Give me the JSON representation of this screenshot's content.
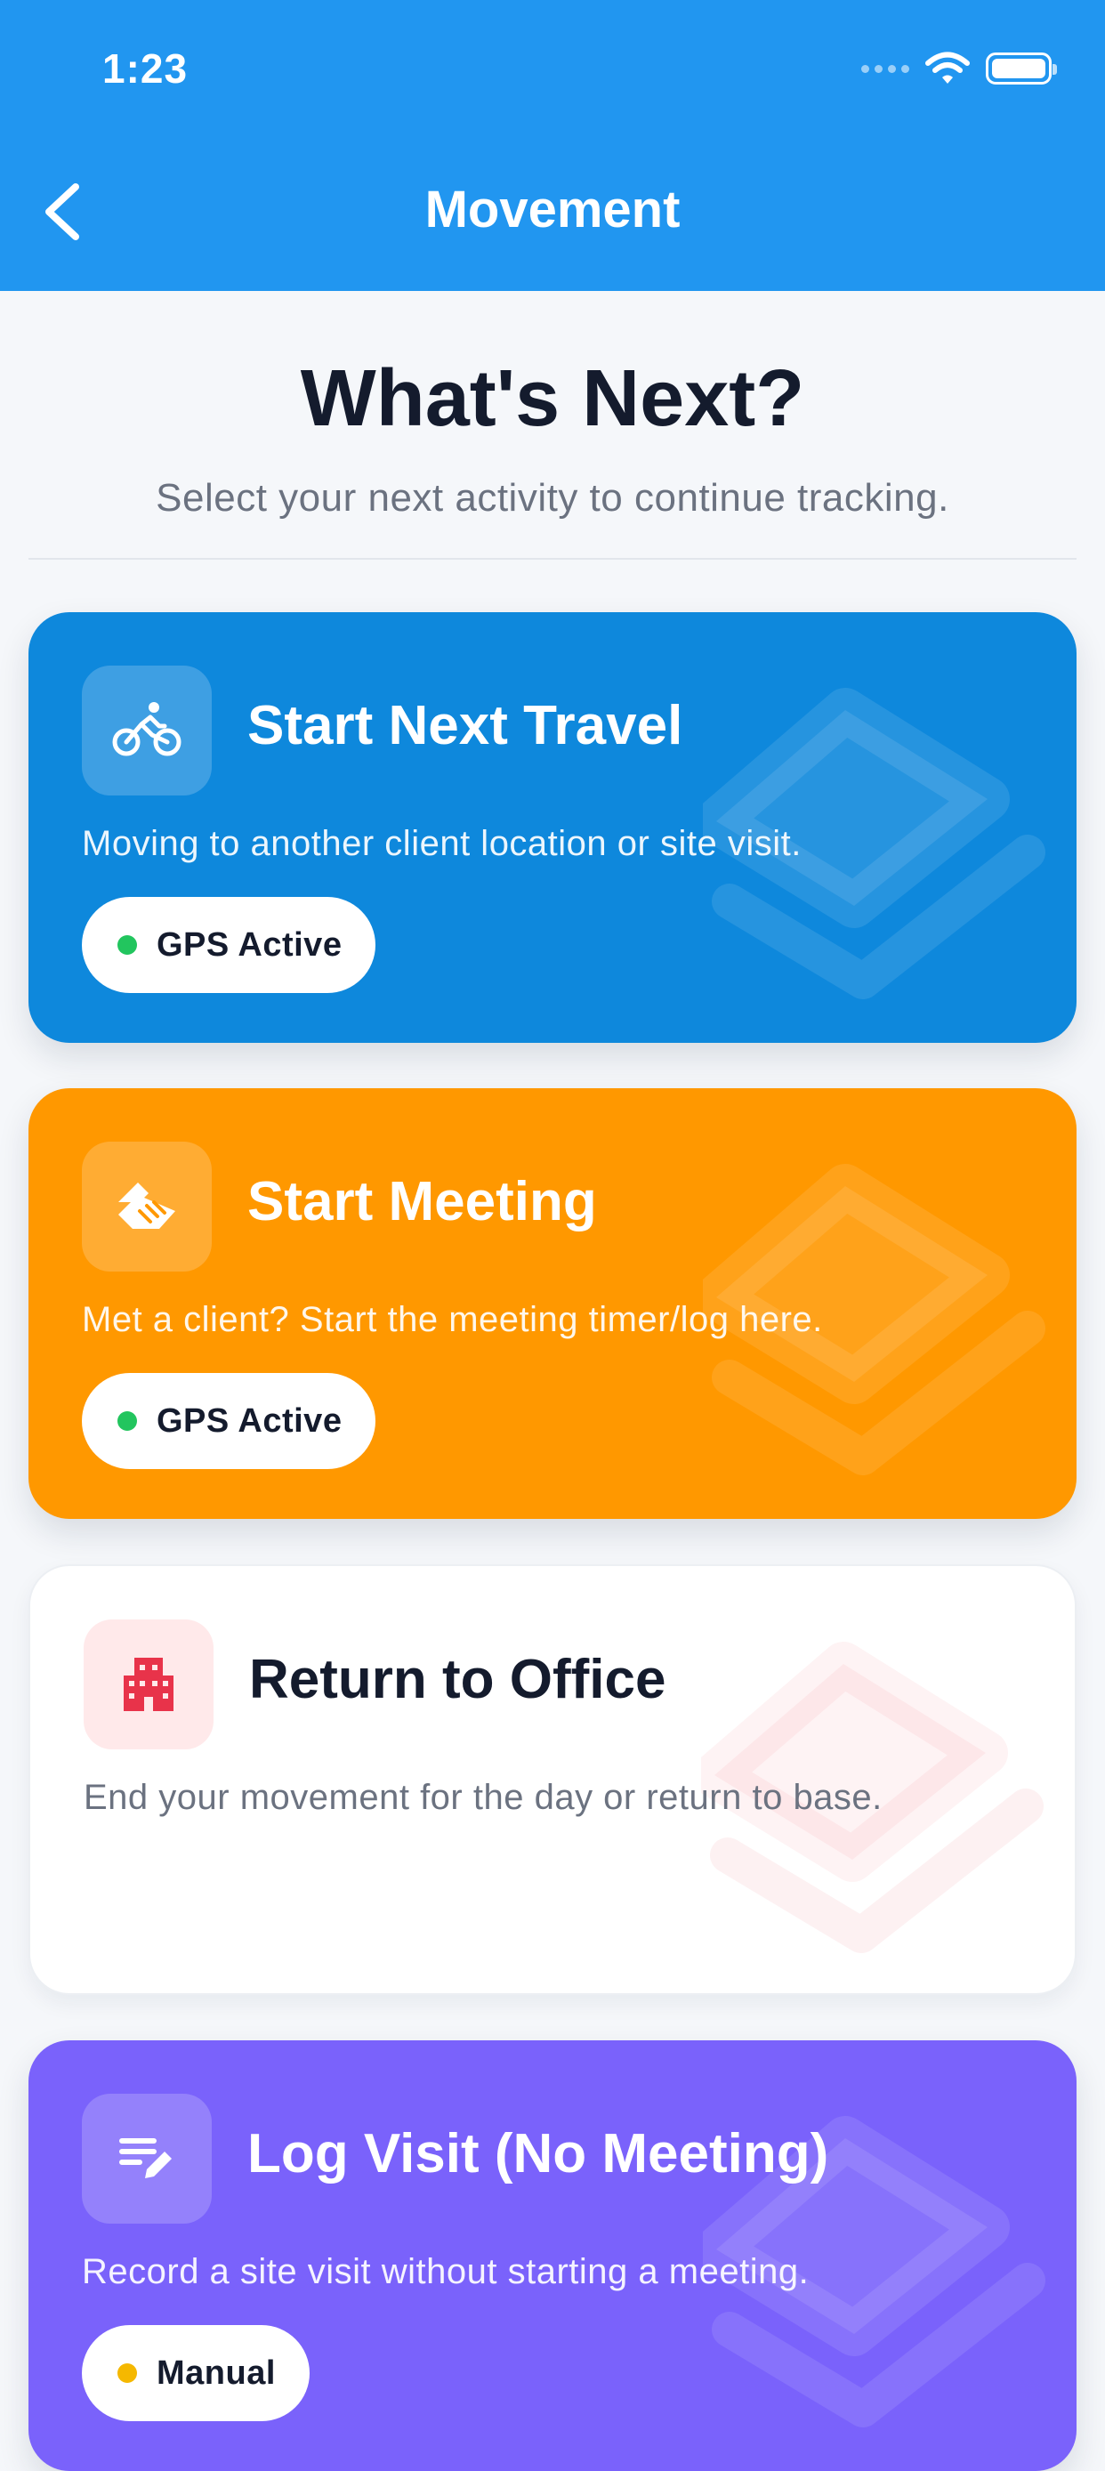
{
  "status_bar": {
    "time": "1:23"
  },
  "nav": {
    "title": "Movement"
  },
  "intro": {
    "heading": "What's Next?",
    "subheading": "Select your next activity to continue tracking."
  },
  "cards": [
    {
      "title": "Start Next Travel",
      "description": "Moving to another client location or site visit.",
      "badge": "GPS Active",
      "icon": "bicycle-icon",
      "color": "#0e88dc"
    },
    {
      "title": "Start Meeting",
      "description": "Met a client? Start the meeting timer/log here.",
      "badge": "GPS Active",
      "icon": "handshake-icon",
      "color": "#ff9800"
    },
    {
      "title": "Return to Office",
      "description": "End your movement for the day or return to base.",
      "icon": "building-icon",
      "color": "#ffffff"
    },
    {
      "title": "Log Visit (No Meeting)",
      "description": "Record a site visit without starting a meeting.",
      "badge": "Manual",
      "icon": "edit-note-icon",
      "color": "#7a62fb"
    }
  ],
  "colors": {
    "appbar": "#2196f0",
    "gps_dot": "#22c55e",
    "manual_dot": "#f5b800",
    "office_icon": "#e8334a"
  }
}
